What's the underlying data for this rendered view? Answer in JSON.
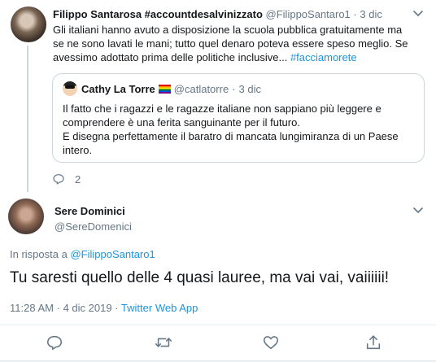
{
  "parent_tweet": {
    "display_name": "Filippo Santarosa #accountdesalvinizzato",
    "handle": "@FilippoSantaro1",
    "separator": "·",
    "date": "3 dic",
    "text_line1": "Gli italiani hanno avuto a disposizione la scuola pubblica gratuitamente ma",
    "text_line2": "se ne sono lavati le mani; tutto quel denaro poteva essere speso meglio. Se",
    "text_line3": "avessimo adottato prima delle politiche inclusive...",
    "hashtag": "#facciamorete",
    "reply_count": "2"
  },
  "quoted_tweet": {
    "display_name": "Cathy La Torre",
    "handle": "@catlatorre",
    "separator": "·",
    "date": "3 dic",
    "text_line1": "Il fatto che i ragazzi e le ragazze italiane non sappiano più leggere e",
    "text_line2": "comprendere è una ferita sanguinante per il futuro.",
    "text_line3": "E disegna perfettamente il baratro di mancata lungimiranza di un Paese",
    "text_line4": "intero."
  },
  "main_tweet": {
    "display_name": "Sere Dominici",
    "handle": "@SereDomenici",
    "reply_prefix": "In risposta a",
    "reply_to": "@FilippoSantaro1",
    "text": "Tu saresti quello delle 4 quasi lauree, ma vai vai, vaiiiiii!",
    "time": "11:28 AM",
    "separator": "·",
    "date": "4 dic 2019",
    "source": "Twitter Web App"
  },
  "icons": {
    "caret": "chevron-down-icon",
    "reply": "reply-icon",
    "retweet": "retweet-icon",
    "like": "heart-icon",
    "share": "share-icon",
    "flag": "rainbow-flag-icon"
  },
  "colors": {
    "link": "#1b95e0",
    "muted": "#657786",
    "text": "#14171a",
    "border": "#ccd6dd"
  }
}
